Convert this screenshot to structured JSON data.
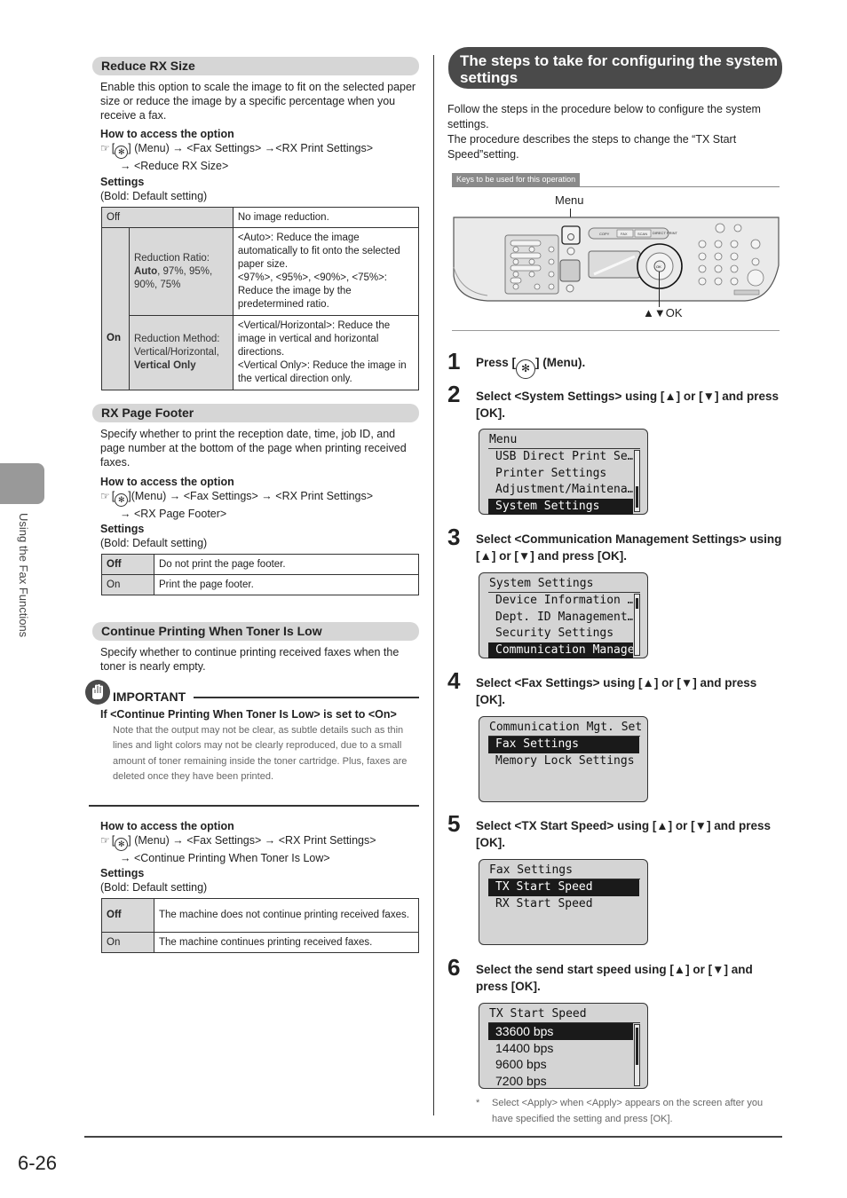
{
  "side": {
    "chapter_label": "Using the Fax Functions"
  },
  "page_number": "6-26",
  "left": {
    "reduce_rx": {
      "title": "Reduce RX Size",
      "desc": "Enable this option to scale the image to fit on the selected paper size or reduce the image by a specific percentage when you receive a fax.",
      "access_heading": "How to access the option",
      "access_line1": "] (Menu) → <Fax Settings> →<RX Print Settings>",
      "access_line2": "→ <Reduce RX Size>",
      "settings_heading": "Settings",
      "settings_note": "(Bold: Default setting)",
      "table": {
        "off_label": "Off",
        "off_desc": "No image reduction.",
        "on_label": "On",
        "ratio_label": "Reduction Ratio:",
        "ratio_default": "Auto",
        "ratio_rest": ", 97%, 95%, 90%, 75%",
        "ratio_desc1": "<Auto>: Reduce the image automatically to fit onto the selected paper size.",
        "ratio_desc2": "<97%>, <95%>, <90%>, <75%>: Reduce the image by the predetermined ratio.",
        "method_label": "Reduction Method: Vertical/Horizontal,",
        "method_default": "Vertical Only",
        "method_desc1": "<Vertical/Horizontal>: Reduce the image in vertical and horizontal directions.",
        "method_desc2": "<Vertical Only>: Reduce the image in the vertical direction only."
      }
    },
    "rx_footer": {
      "title": "RX Page Footer",
      "desc": "Specify whether to print the reception date, time, job ID, and page number at the bottom of the page when printing received faxes.",
      "access_heading": "How to access the option",
      "access_line1": "](Menu) → <Fax Settings> → <RX Print Settings>",
      "access_line2": "→ <RX Page Footer>",
      "settings_heading": "Settings",
      "settings_note": "(Bold: Default setting)",
      "rows": [
        {
          "label": "Off",
          "desc": "Do not print the page footer."
        },
        {
          "label": "On",
          "desc": "Print the page footer."
        }
      ]
    },
    "toner_low": {
      "title": "Continue Printing When Toner Is Low",
      "desc": "Specify whether to continue printing received faxes when the toner is nearly empty.",
      "important_label": "IMPORTANT",
      "important_heading": "If <Continue Printing When Toner Is Low> is set to <On>",
      "important_note": "Note that the output may not be clear, as subtle details such as thin lines and light colors may not be clearly reproduced, due to a small amount of toner remaining inside the toner cartridge. Plus, faxes are deleted once they have been printed.",
      "access_heading": "How to access the option",
      "access_line1": "] (Menu) → <Fax Settings> → <RX Print Settings>",
      "access_line2": "→ <Continue Printing When Toner Is Low>",
      "settings_heading": "Settings",
      "settings_note": "(Bold: Default setting)",
      "rows": [
        {
          "label": "Off",
          "desc": "The machine does not continue printing received faxes."
        },
        {
          "label": "On",
          "desc": "The machine continues printing received faxes."
        }
      ]
    },
    "access_prefix": "[",
    "menu_glyph": "✻"
  },
  "right": {
    "title": "The steps to take for configuring the system settings",
    "intro1": "Follow the steps in the procedure below to configure the system settings.",
    "intro2": "The procedure describes the steps to change the “TX Start Speed”setting.",
    "keys_tag": "Keys to be used for this operation",
    "panel": {
      "menu_label": "Menu",
      "ok_label": "▲▼OK",
      "mode_buttons": [
        "COPY",
        "FAX",
        "SCAN",
        "DIRECT PRINT"
      ]
    },
    "steps": [
      {
        "num": "1",
        "text_a": "Press [",
        "text_b": "] (Menu)."
      },
      {
        "num": "2",
        "text": "Select <System Settings> using [▲] or [▼] and press [OK].",
        "lcd": {
          "title": "Menu",
          "items": [
            "USB Direct Print Se…",
            "Printer Settings",
            "Adjustment/Maintena…",
            "System Settings"
          ],
          "selected": 3
        }
      },
      {
        "num": "3",
        "text": "Select <Communication Management Settings> using [▲] or [▼] and press [OK].",
        "lcd": {
          "title": "System Settings",
          "items": [
            "Device Information …",
            "Dept. ID Management…",
            "Security Settings",
            "Communication Manage"
          ],
          "selected": 3
        }
      },
      {
        "num": "4",
        "text": "Select <Fax Settings> using [▲] or [▼] and press [OK].",
        "lcd": {
          "title": "Communication Mgt. Set",
          "items": [
            "Fax Settings",
            "Memory Lock Settings"
          ],
          "selected": 0
        }
      },
      {
        "num": "5",
        "text": "Select <TX Start Speed> using [▲] or [▼] and press [OK].",
        "lcd": {
          "title": "Fax Settings",
          "items": [
            "TX Start Speed",
            "RX Start Speed"
          ],
          "selected": 0
        }
      },
      {
        "num": "6",
        "text": "Select the send start speed using [▲] or [▼] and press [OK].",
        "lcd": {
          "title": "TX Start Speed",
          "items": [
            "33600 bps",
            "14400 bps",
            "9600 bps",
            "7200 bps"
          ],
          "selected": 0
        }
      }
    ],
    "footnote_star": "*",
    "footnote": "Select <Apply> when <Apply> appears on the screen after you have specified the setting and press [OK]."
  }
}
